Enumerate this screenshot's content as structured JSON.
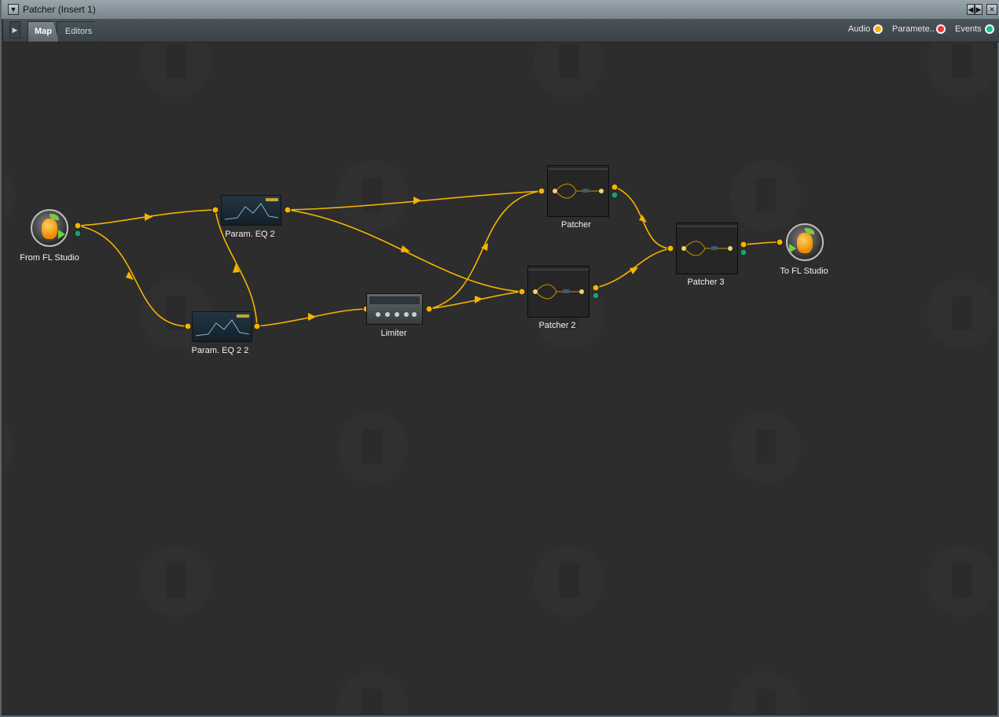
{
  "window": {
    "title": "Patcher (Insert 1)"
  },
  "tabs": [
    {
      "label": "Map"
    },
    {
      "label": "Editors"
    }
  ],
  "legend": [
    {
      "label": "Audio",
      "color": "#f5b400"
    },
    {
      "label": "Paramete..",
      "color": "#e8353f"
    },
    {
      "label": "Events",
      "color": "#19c08a"
    }
  ],
  "nodes": {
    "from_fl": {
      "label": "From FL Studio",
      "icon": "fl-studio-icon"
    },
    "param_eq2": {
      "label": "Param. EQ 2"
    },
    "param_eq22": {
      "label": "Param. EQ 2 2"
    },
    "limiter": {
      "label": "Limiter"
    },
    "patcher": {
      "label": "Patcher"
    },
    "patcher2": {
      "label": "Patcher 2"
    },
    "patcher3": {
      "label": "Patcher 3"
    },
    "to_fl": {
      "label": "To FL Studio",
      "icon": "fl-studio-icon"
    }
  },
  "colors": {
    "wire": "#f5b400",
    "port_out": "#f5b400",
    "port_event": "#19a070"
  }
}
